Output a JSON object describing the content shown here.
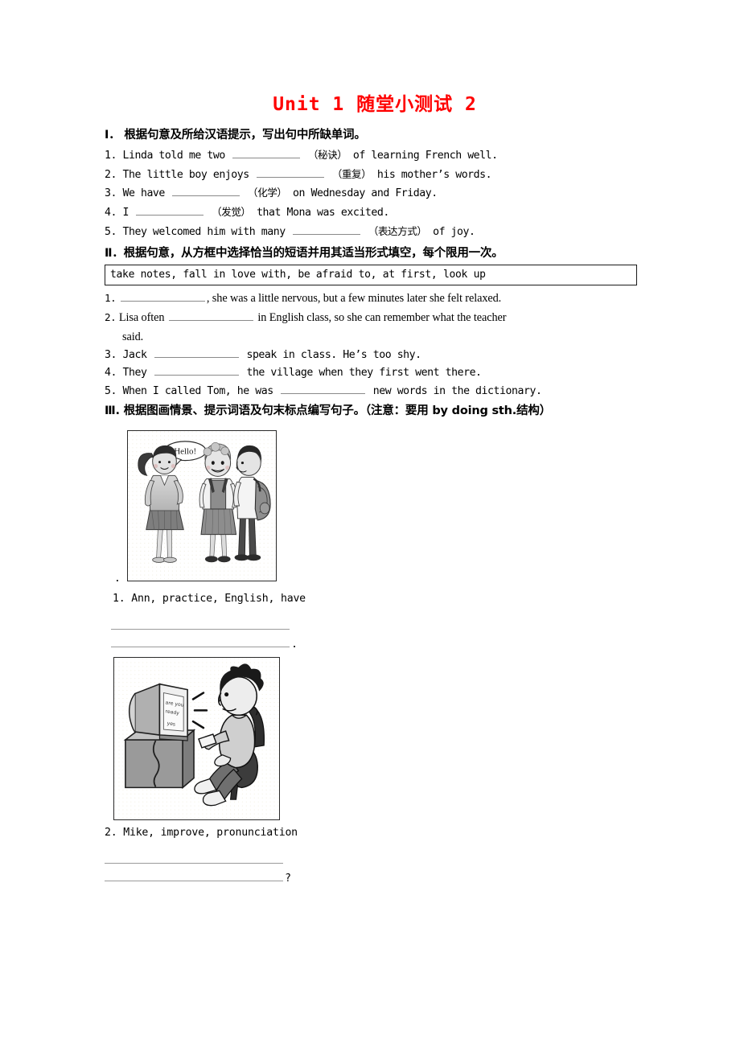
{
  "document": {
    "title": "Unit 1 随堂小测试 2",
    "title_color": "#ff0000"
  },
  "section_1": {
    "heading": "Ⅰ． 根据句意及所给汉语提示，写出句中所缺单词。",
    "items": [
      {
        "num": "1.",
        "before": "Linda told me two",
        "hint": "（秘诀）",
        "after": "of learning French well."
      },
      {
        "num": "2.",
        "before": "The little boy enjoys",
        "hint": "（重复）",
        "after": "his mother’s words."
      },
      {
        "num": "3.",
        "before": "We have",
        "hint": "（化学）",
        "after": "on Wednesday and Friday."
      },
      {
        "num": "4.",
        "before": "I",
        "hint": "（发觉）",
        "after": "that Mona was excited."
      },
      {
        "num": "5.",
        "before": "They welcomed him with many",
        "hint": "（表达方式）",
        "after": "of joy."
      }
    ]
  },
  "section_2": {
    "heading": "Ⅱ．根据句意，从方框中选择恰当的短语并用其适当形式填空，每个限用一次。",
    "word_bank": "take notes, fall in love with, be afraid to, at first, look up",
    "items": [
      {
        "num": "1.",
        "before": "",
        "after": ", she was a little nervous, but a few minutes later she felt relaxed."
      },
      {
        "num": "2.",
        "before": "Lisa often",
        "after": "in English class, so she can remember what the teacher"
      },
      {
        "num": "2b",
        "continuation": "said."
      },
      {
        "num": "3.",
        "before": "Jack",
        "after": "speak in class. He’s too shy."
      },
      {
        "num": "4.",
        "before": "They",
        "after": "the village when they first went there."
      },
      {
        "num": "5.",
        "before": "When I called Tom, he was",
        "after": "new words in the dictionary."
      }
    ]
  },
  "section_3": {
    "heading": "Ⅲ. 根据图画情景、提示词语及句末标点编写句子。（注意：要用 by doing sth.结构）",
    "figure_1": {
      "name": "three-students-greeting-illustration",
      "speech_bubble": "Hello!",
      "trailing_punct": "."
    },
    "prompt_1": "1. Ann, practice, English, have",
    "answer_1_endmark": ".",
    "figure_2": {
      "name": "boy-at-computer-illustration",
      "screen_line_1": "are you",
      "screen_line_2": "ready",
      "screen_line_3": "yes"
    },
    "prompt_2": "2. Mike, improve, pronunciation",
    "answer_2_endmark": "?"
  }
}
